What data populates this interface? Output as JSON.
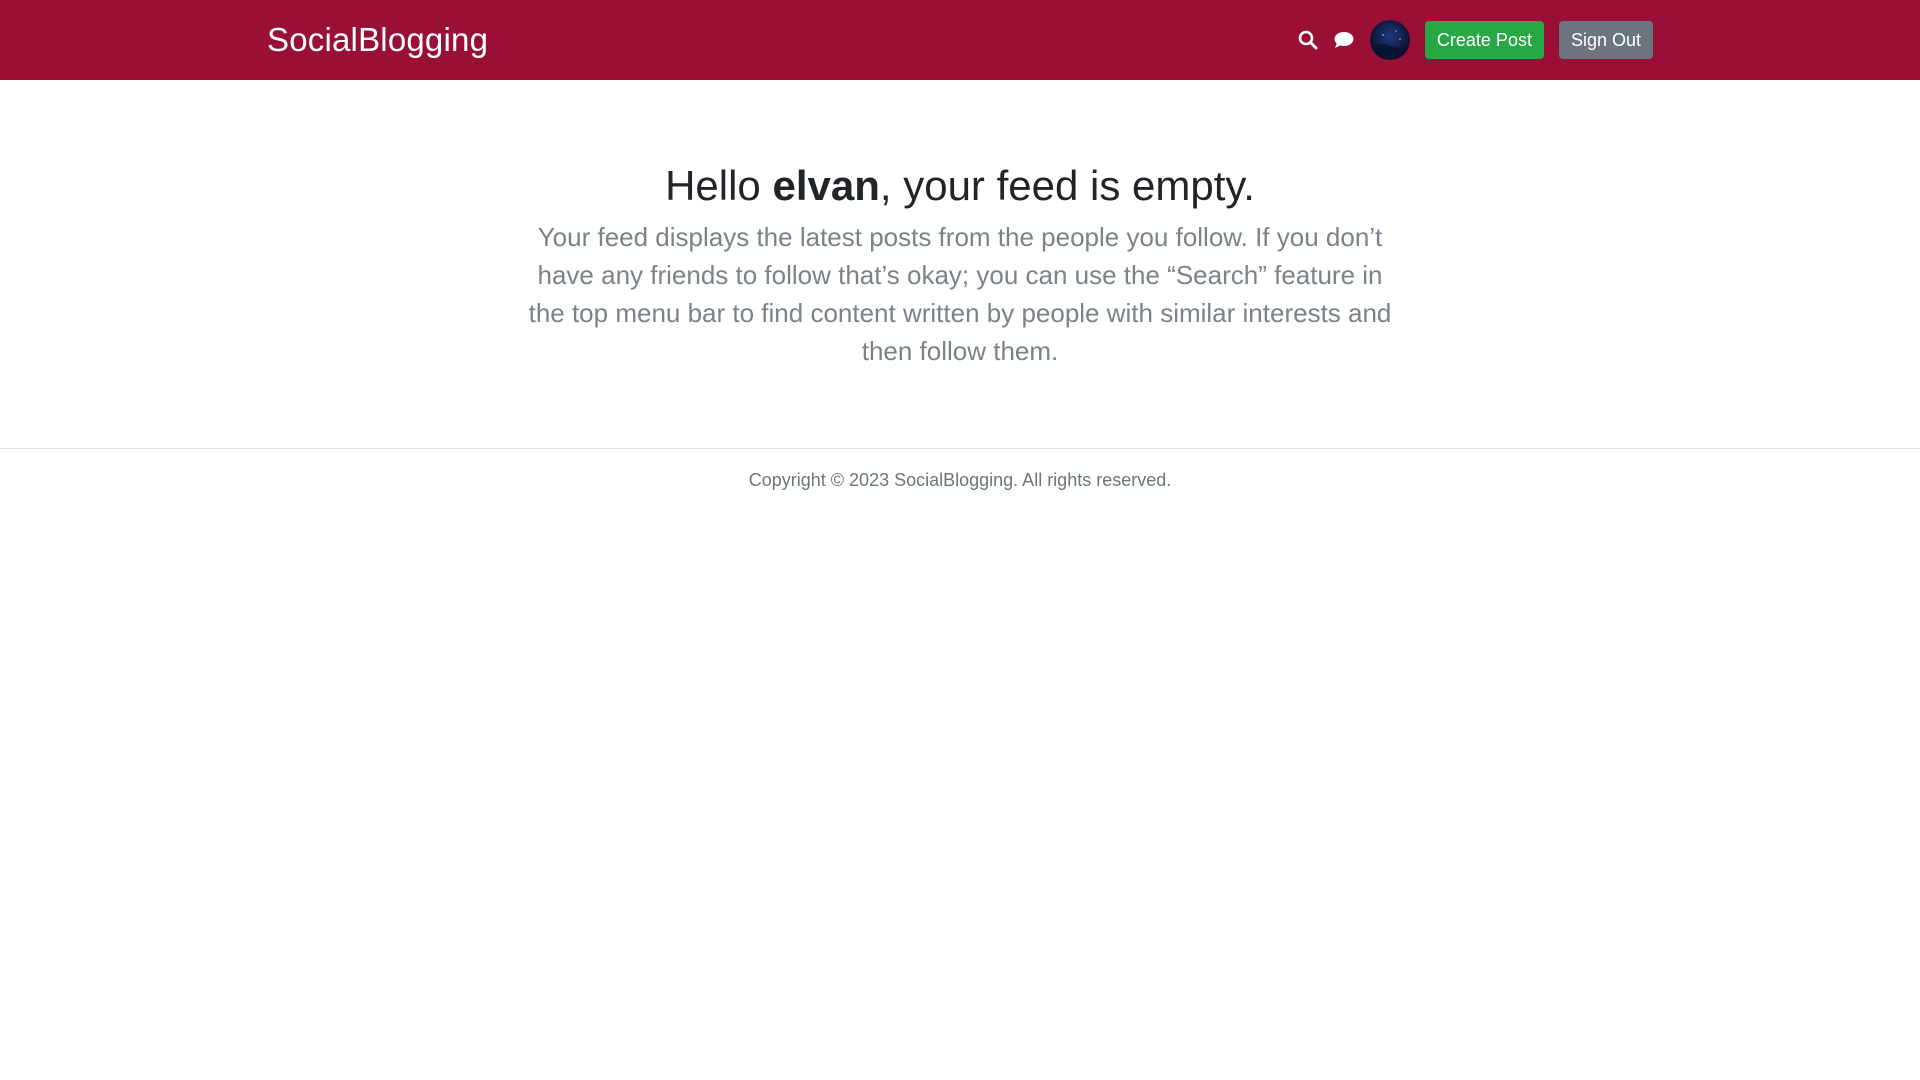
{
  "navbar": {
    "brand": "SocialBlogging",
    "icons": {
      "search": "search-icon",
      "messages": "chat-bubble-icon"
    },
    "create_post_label": "Create Post",
    "sign_out_label": "Sign Out",
    "colors": {
      "background": "#990f36",
      "create": "#28a745",
      "signout": "#6c757d"
    }
  },
  "hero": {
    "greeting": "Hello ",
    "username": "elvan",
    "title_suffix": ", your feed is empty.",
    "lead": "Your feed displays the latest posts from the people you follow. If you don’t have any friends to follow that’s okay; you can use the “Search” feature in the top menu bar to find content written by people with similar interests and then follow them."
  },
  "footer": {
    "copyright": "Copyright © 2023 SocialBlogging. All rights reserved."
  }
}
